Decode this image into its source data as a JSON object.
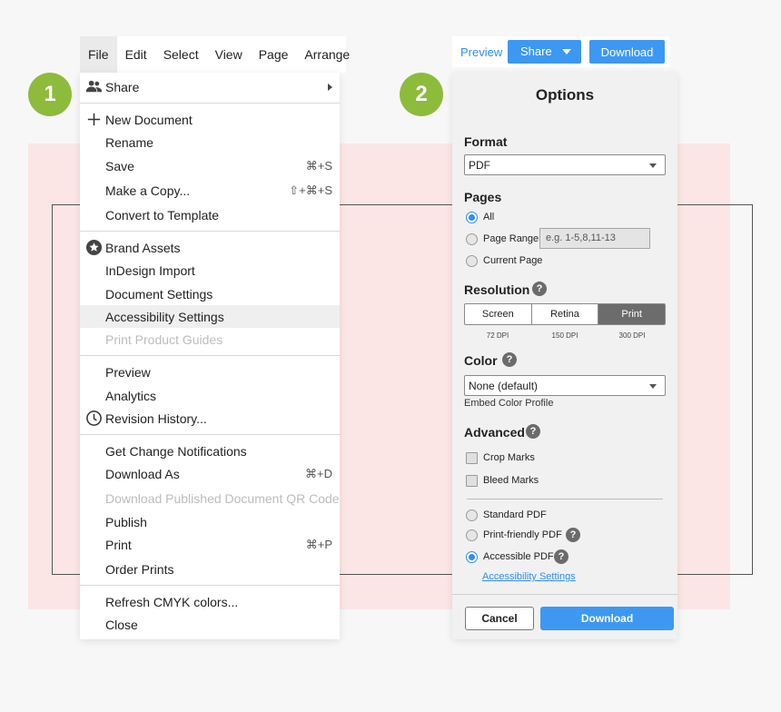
{
  "badges": {
    "step1": "1",
    "step2": "2"
  },
  "menubar": {
    "items": [
      "File",
      "Edit",
      "Select",
      "View",
      "Page",
      "Arrange"
    ],
    "active": "File"
  },
  "file_menu": {
    "share": "Share",
    "new_document": "New Document",
    "rename": "Rename",
    "save": {
      "label": "Save",
      "shortcut": "⌘+S"
    },
    "make_copy": {
      "label": "Make a Copy...",
      "shortcut": "⇧+⌘+S"
    },
    "convert_template": "Convert to Template",
    "brand_assets": "Brand Assets",
    "indesign_import": "InDesign Import",
    "document_settings": "Document Settings",
    "accessibility_settings": "Accessibility Settings",
    "print_product_guides": "Print Product Guides",
    "preview": "Preview",
    "analytics": "Analytics",
    "revision_history": "Revision History...",
    "get_change_notifications": "Get Change Notifications",
    "download_as": {
      "label": "Download As",
      "shortcut": "⌘+D"
    },
    "download_qr": "Download Published Document QR Code",
    "publish": "Publish",
    "print": {
      "label": "Print",
      "shortcut": "⌘+P"
    },
    "order_prints": "Order Prints",
    "refresh_cmyk": "Refresh CMYK colors...",
    "close": "Close"
  },
  "toolbar": {
    "preview": "Preview",
    "share": "Share",
    "download": "Download"
  },
  "options": {
    "title": "Options",
    "format": {
      "heading": "Format",
      "value": "PDF"
    },
    "pages": {
      "heading": "Pages",
      "all": "All",
      "page_range": "Page Range",
      "range_placeholder": "e.g. 1-5,8,11-13",
      "current_page": "Current Page",
      "selected": "All"
    },
    "resolution": {
      "heading": "Resolution",
      "options": [
        {
          "label": "Screen",
          "dpi": "72 DPI"
        },
        {
          "label": "Retina",
          "dpi": "150 DPI"
        },
        {
          "label": "Print",
          "dpi": "300 DPI"
        }
      ],
      "selected": "Print"
    },
    "color": {
      "heading": "Color",
      "value": "None (default)",
      "note": "Embed Color Profile"
    },
    "advanced": {
      "heading": "Advanced",
      "crop_marks": "Crop Marks",
      "bleed_marks": "Bleed Marks",
      "standard_pdf": "Standard PDF",
      "print_friendly_pdf": "Print-friendly PDF",
      "accessible_pdf": "Accessible PDF",
      "selected": "Accessible PDF",
      "link": "Accessibility Settings"
    },
    "help_glyph": "?",
    "cancel": "Cancel",
    "download": "Download"
  },
  "colors": {
    "accent": "#3d98f2",
    "badge": "#8dbb3c",
    "band": "#fbe6e5"
  }
}
